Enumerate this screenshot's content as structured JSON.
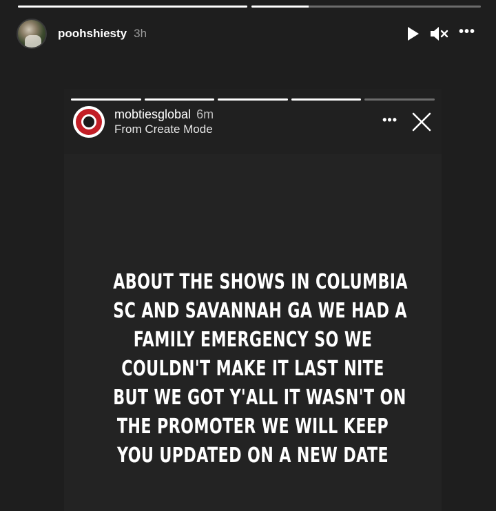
{
  "outer_story": {
    "username": "poohshiesty",
    "time": "3h",
    "progress": [
      1.0,
      0.25
    ],
    "controls": {
      "play_icon": "play-icon",
      "mute_icon": "muted-speaker-icon",
      "more_icon": "more-options-icon",
      "more_label": "•••"
    }
  },
  "inner_story": {
    "username": "mobtiesglobal",
    "time": "6m",
    "subtitle": "From Create Mode",
    "progress": [
      1.0,
      1.0,
      1.0,
      1.0,
      0.0
    ],
    "controls": {
      "more_label": "•••",
      "more_icon": "more-options-icon",
      "close_icon": "close-icon"
    },
    "text_lines": [
      "ABOUT THE SHOWS IN COLUMBIA",
      "SC AND SAVANNAH GA WE HAD A",
      "FAMILY EMERGENCY SO WE",
      "COULDN'T MAKE IT LAST NITE",
      "BUT WE GOT Y'ALL IT WASN'T ON",
      "THE PROMOTER WE WILL KEEP",
      "YOU UPDATED ON A NEW DATE"
    ]
  },
  "colors": {
    "background": "#1e1e1e",
    "brand_red": "#c21e26"
  }
}
